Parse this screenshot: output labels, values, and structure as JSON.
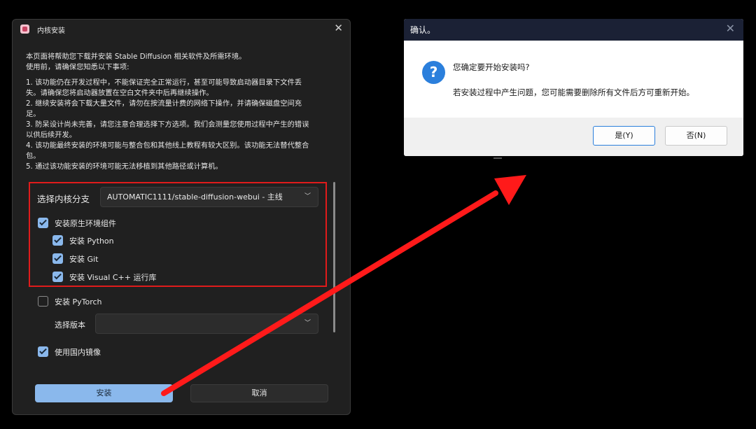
{
  "install_window": {
    "title": "内核安装",
    "intro_lines": [
      "本页面将帮助您下载并安装 Stable Diffusion 相关软件及所需环境。",
      "使用前，请确保您知悉以下事项:",
      "1. 该功能仍在开发过程中，不能保证完全正常运行，甚至可能导致启动器目录下文件丢",
      "失。请确保您将启动器放置在空白文件夹中后再继续操作。",
      "2. 继续安装将会下载大量文件，请勿在按流量计费的网络下操作，并请确保磁盘空间充",
      "足。",
      "3. 防呆设计尚未完善，请您注意合理选择下方选项。我们会测量您使用过程中产生的错误",
      "以供后续开发。",
      "4. 该功能最终安装的环境可能与整合包和其他线上教程有较大区别。该功能无法替代整合",
      "包。",
      "5. 通过该功能安装的环境可能无法移植到其他路径或计算机。"
    ],
    "branch_label": "选择内核分支",
    "branch_value": "AUTOMATIC1111/stable-diffusion-webui - 主线",
    "opt_env": "安装原生环境组件",
    "opt_python": "安装 Python",
    "opt_git": "安装 Git",
    "opt_vcpp": "安装 Visual C++ 运行库",
    "opt_pytorch": "安装 PyTorch",
    "version_label": "选择版本",
    "version_value": "",
    "opt_mirror": "使用国内镜像",
    "install_btn": "安装",
    "cancel_btn": "取消"
  },
  "confirm_dialog": {
    "title": "确认。",
    "question": "您确定要开始安装吗?",
    "detail": "若安装过程中产生问题，您可能需要删除所有文件后方可重新开始。",
    "yes_btn": "是(Y)",
    "no_btn": "否(N)"
  },
  "colors": {
    "accent": "#8ab8ec",
    "highlight_box": "#e01b1b",
    "arrow": "#ff1a1a",
    "question_icon": "#2b7fdc"
  },
  "icons": {
    "app": "app-logo-icon",
    "close": "close-icon",
    "question": "question-icon",
    "chevron": "chevron-down-icon",
    "check": "checkmark-icon"
  }
}
